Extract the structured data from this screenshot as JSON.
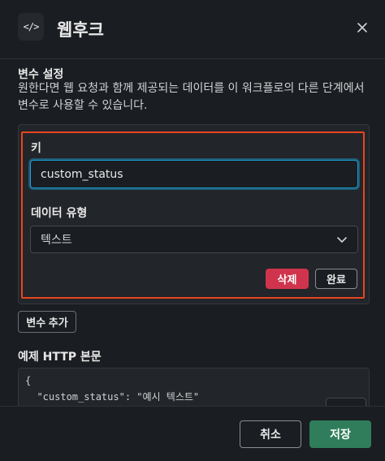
{
  "header": {
    "icon_glyph": "</>",
    "title": "웹후크"
  },
  "variables": {
    "title": "변수 설정",
    "description": "원한다면 웹 요청과 함께 제공되는 데이터를 이 워크플로의 다른 단계에서 변수로 사용할 수 있습니다.",
    "key_label": "키",
    "key_value": "custom_status",
    "type_label": "데이터 유형",
    "type_value": "텍스트",
    "delete_label": "삭제",
    "done_label": "완료",
    "add_label": "변수 추가"
  },
  "example": {
    "title": "예제 HTTP 본문",
    "code_lines": [
      "{",
      "  \"custom_status\": \"예시 텍스트\""
    ]
  },
  "footer": {
    "cancel_label": "취소",
    "save_label": "저장"
  },
  "colors": {
    "delete": "#d0344c",
    "save": "#2f7d5a",
    "focus_ring": "#1d9bd1",
    "highlight": "#e8451f"
  }
}
